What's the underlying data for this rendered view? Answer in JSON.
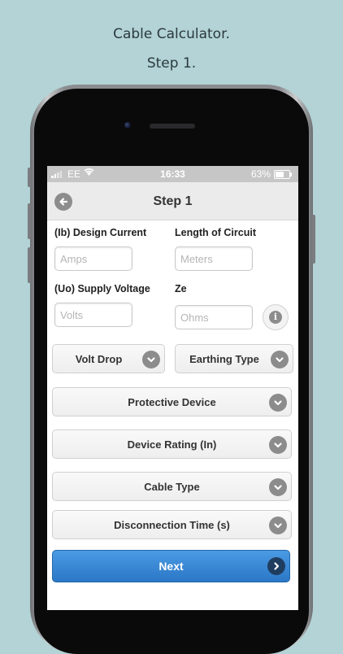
{
  "caption": {
    "title": "Cable Calculator.",
    "step": "Step 1."
  },
  "status_bar": {
    "carrier": "EE",
    "time": "16:33",
    "battery": "63%"
  },
  "navbar": {
    "title": "Step 1",
    "back_icon": "back-arrow-icon"
  },
  "fields": {
    "design_current": {
      "label": "(Ib) Design Current",
      "placeholder": "Amps"
    },
    "circuit_length": {
      "label": "Length of Circuit",
      "placeholder": "Meters"
    },
    "supply_voltage": {
      "label": "(Uo) Supply Voltage",
      "placeholder": "Volts"
    },
    "ze": {
      "label": "Ze",
      "placeholder": "Ohms"
    }
  },
  "selects": {
    "volt_drop": "Volt Drop",
    "earthing_type": "Earthing Type",
    "protective_device": "Protective Device",
    "device_rating": "Device Rating (In)",
    "cable_type": "Cable Type",
    "disconnection_time": "Disconnection Time (s)"
  },
  "next_button": {
    "label": "Next"
  },
  "colors": {
    "background": "#b3d3d6",
    "accent": "#2b78c6",
    "icon_grey": "#8c8c8c"
  }
}
